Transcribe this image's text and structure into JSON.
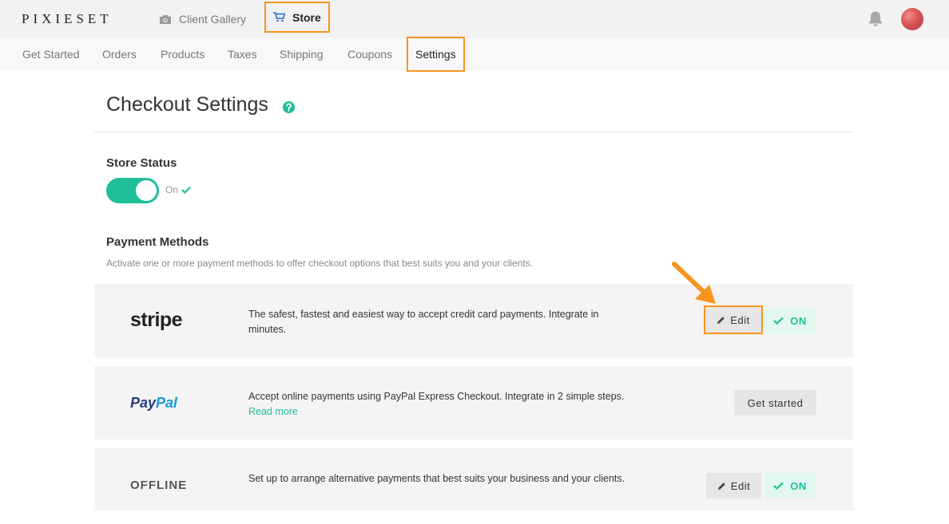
{
  "brand": "PIXIESET",
  "top_nav": {
    "client_gallery": "Client Gallery",
    "store": "Store"
  },
  "sub_nav": [
    "Get Started",
    "Orders",
    "Products",
    "Taxes",
    "Shipping",
    "Coupons",
    "Settings"
  ],
  "page": {
    "title": "Checkout Settings"
  },
  "store_status": {
    "label": "Store Status",
    "state": "On"
  },
  "payment_methods": {
    "label": "Payment Methods",
    "description": "Activate one or more payment methods to offer checkout options that best suits you and your clients.",
    "stripe": {
      "logo": "stripe",
      "text": "The safest, fastest and easiest way to accept credit card payments. Integrate in minutes.",
      "edit": "Edit",
      "status": "ON"
    },
    "paypal": {
      "logo_pay": "Pay",
      "logo_pal": "Pal",
      "text": "Accept online payments using PayPal Express Checkout. Integrate in 2 simple steps.",
      "read_more": "Read more",
      "button": "Get started"
    },
    "offline": {
      "logo": "OFFLINE",
      "text": "Set up to arrange alternative payments that best suits your business and your clients.",
      "edit": "Edit",
      "status": "ON"
    }
  },
  "colors": {
    "accent": "#1fbf99",
    "highlight": "#f7941d",
    "store_icon": "#3a7bd5"
  }
}
